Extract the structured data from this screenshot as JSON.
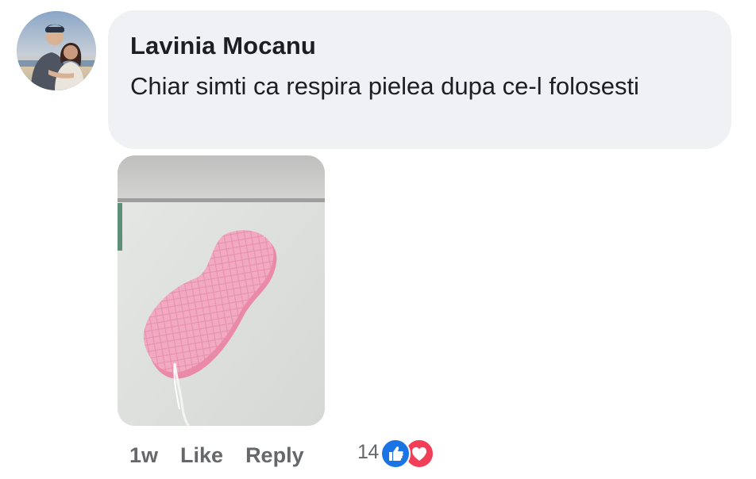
{
  "comment": {
    "author": "Lavinia Mocanu",
    "text": "Chiar simti ca respira pielea dupa ce-l folosesti",
    "avatar_icon": "profile-photo-couple",
    "photo_icon": "pink-bath-sponge-photo"
  },
  "actions": {
    "time": "1w",
    "like_label": "Like",
    "reply_label": "Reply"
  },
  "reactions": {
    "count": "14",
    "icons": [
      "like-icon",
      "love-icon"
    ],
    "colors": {
      "like": "#1b74e4",
      "love": "#f33e58"
    }
  },
  "colors": {
    "bubble_bg": "#eff1f5",
    "text": "#1c1e21",
    "meta": "#65676b"
  }
}
